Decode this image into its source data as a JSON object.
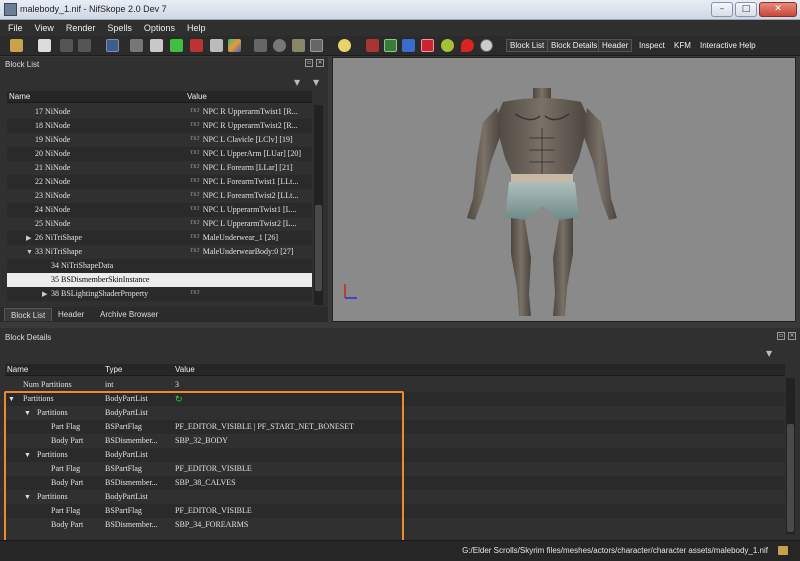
{
  "window": {
    "title": "malebody_1.nif - NifSkope 2.0 Dev 7",
    "buttons": {
      "minimize": "–",
      "maximize": "□",
      "close": "✕"
    }
  },
  "menu": [
    "File",
    "View",
    "Render",
    "Spells",
    "Options",
    "Help"
  ],
  "toolbar": {
    "block_list": "Block List",
    "block_details": "Block Details",
    "header": "Header",
    "inspect": "Inspect",
    "kfm": "KFM",
    "interactive_help": "Interactive Help"
  },
  "block_list": {
    "title": "Block List",
    "columns": {
      "name": "Name",
      "value": "Value"
    },
    "rows": [
      {
        "name": "17 NiNode",
        "value": "NPC R UpperarmTwist1 [R..."
      },
      {
        "name": "18 NiNode",
        "value": "NPC R UpperarmTwist2 [R..."
      },
      {
        "name": "19 NiNode",
        "value": "NPC L Clavicle [LClv] [19]"
      },
      {
        "name": "20 NiNode",
        "value": "NPC L UpperArm [LUar] [20]"
      },
      {
        "name": "21 NiNode",
        "value": "NPC L Forearm [LLar] [21]"
      },
      {
        "name": "22 NiNode",
        "value": "NPC L ForearmTwist1 [LLt..."
      },
      {
        "name": "23 NiNode",
        "value": "NPC L ForearmTwist2 [LLt..."
      },
      {
        "name": "24 NiNode",
        "value": "NPC L UpperarmTwist1 [L..."
      },
      {
        "name": "25 NiNode",
        "value": "NPC L UpperarmTwist2 [L..."
      },
      {
        "name": "26 NiTriShape",
        "value": "MaleUnderwear_1 [26]"
      },
      {
        "name": "33 NiTriShape",
        "value": "MaleUnderwearBody:0 [27]"
      },
      {
        "name": "34 NiTriShapeData",
        "value": ""
      },
      {
        "name": "35 BSDismemberSkinInstance",
        "value": ""
      },
      {
        "name": "38 BSLightingShaderProperty",
        "value": ""
      }
    ],
    "tabs": [
      "Block List",
      "Header",
      "Archive Browser"
    ]
  },
  "block_details": {
    "title": "Block Details",
    "columns": {
      "name": "Name",
      "type": "Type",
      "value": "Value"
    },
    "rows": [
      {
        "name": "Num Partitions",
        "type": "int",
        "value": "3"
      },
      {
        "name": "Partitions",
        "type": "BodyPartList",
        "value": ""
      },
      {
        "name": "Partitions",
        "type": "BodyPartList",
        "value": ""
      },
      {
        "name": "Part Flag",
        "type": "BSPartFlag",
        "value": "PF_EDITOR_VISIBLE | PF_START_NET_BONESET"
      },
      {
        "name": "Body Part",
        "type": "BSDismember...",
        "value": "SBP_32_BODY"
      },
      {
        "name": "Partitions",
        "type": "BodyPartList",
        "value": ""
      },
      {
        "name": "Part Flag",
        "type": "BSPartFlag",
        "value": "PF_EDITOR_VISIBLE"
      },
      {
        "name": "Body Part",
        "type": "BSDismember...",
        "value": "SBP_38_CALVES"
      },
      {
        "name": "Partitions",
        "type": "BodyPartList",
        "value": ""
      },
      {
        "name": "Part Flag",
        "type": "BSPartFlag",
        "value": "PF_EDITOR_VISIBLE"
      },
      {
        "name": "Body Part",
        "type": "BSDismember...",
        "value": "SBP_34_FOREARMS"
      }
    ]
  },
  "status": {
    "path": "G:/Elder Scrolls/Skyrim files/meshes/actors/character/character assets/malebody_1.nif"
  },
  "colors": {
    "highlight": "#f08a2a",
    "selection": "#ececec"
  }
}
